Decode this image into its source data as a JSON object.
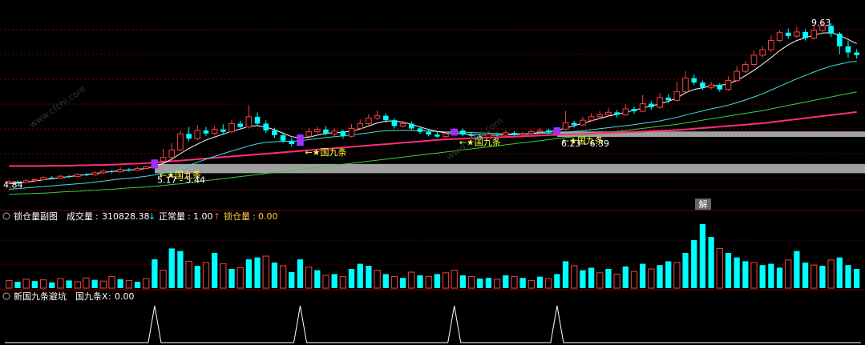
{
  "colors": {
    "background": "#000000",
    "up": "#FF4040",
    "down": "#00FFFF",
    "ma_white": "#FFFFFF",
    "ma_yellow": "#FFD040",
    "ma_magenta": "#FF2E7A",
    "ma_cyan": "#40E0E0",
    "ma_green": "#38D038",
    "signal_purple": "#9B30FF",
    "signal_text": "#FFFF40",
    "grid_red": "#7A0000",
    "band_gray": "#A0A0A0",
    "spike": "#FFFFFF"
  },
  "chart_data": [
    {
      "type": "candlestick",
      "title": "",
      "ylim": [
        4.5,
        10.0
      ],
      "annotations": {
        "high_label": "9.63",
        "low_label": "4.84",
        "band_lower_label": "5.17 - 5.44",
        "band_upper_label": "6.23 - 6.39",
        "signal_label": "←★国九条",
        "button_label": "解"
      },
      "signal_indices": [
        17,
        34,
        52,
        64
      ],
      "band_lower": [
        5.17,
        5.44
      ],
      "band_upper": [
        6.23,
        6.39
      ],
      "candles": [
        [
          4.88,
          4.92,
          4.97,
          4.84
        ],
        [
          4.92,
          4.9,
          4.96,
          4.86
        ],
        [
          4.9,
          4.95,
          4.99,
          4.87
        ],
        [
          4.95,
          4.98,
          5.02,
          4.92
        ],
        [
          4.98,
          5.04,
          5.08,
          4.95
        ],
        [
          5.04,
          5.03,
          5.09,
          4.99
        ],
        [
          5.03,
          5.08,
          5.12,
          5.0
        ],
        [
          5.08,
          5.07,
          5.12,
          5.03
        ],
        [
          5.07,
          5.13,
          5.17,
          5.05
        ],
        [
          5.13,
          5.12,
          5.17,
          5.08
        ],
        [
          5.12,
          5.18,
          5.23,
          5.1
        ],
        [
          5.18,
          5.23,
          5.28,
          5.15
        ],
        [
          5.23,
          5.21,
          5.27,
          5.17
        ],
        [
          5.21,
          5.28,
          5.34,
          5.19
        ],
        [
          5.28,
          5.26,
          5.32,
          5.22
        ],
        [
          5.26,
          5.31,
          5.36,
          5.24
        ],
        [
          5.31,
          5.36,
          5.4,
          5.28
        ],
        [
          5.36,
          5.52,
          5.58,
          5.33
        ],
        [
          5.52,
          5.63,
          5.88,
          5.48
        ],
        [
          5.63,
          5.85,
          6.05,
          5.6
        ],
        [
          5.85,
          6.32,
          6.42,
          5.82
        ],
        [
          6.32,
          6.18,
          6.52,
          6.1
        ],
        [
          6.18,
          6.42,
          6.58,
          6.14
        ],
        [
          6.42,
          6.33,
          6.52,
          6.25
        ],
        [
          6.33,
          6.45,
          6.55,
          6.28
        ],
        [
          6.45,
          6.38,
          6.6,
          6.3
        ],
        [
          6.38,
          6.62,
          6.72,
          6.34
        ],
        [
          6.62,
          6.52,
          6.7,
          6.45
        ],
        [
          6.52,
          6.82,
          7.15,
          6.48
        ],
        [
          6.82,
          6.62,
          6.95,
          6.55
        ],
        [
          6.62,
          6.42,
          6.72,
          6.35
        ],
        [
          6.42,
          6.28,
          6.5,
          6.2
        ],
        [
          6.28,
          6.12,
          6.36,
          6.05
        ],
        [
          6.12,
          6.02,
          6.2,
          5.95
        ],
        [
          6.02,
          6.25,
          6.32,
          5.98
        ],
        [
          6.25,
          6.38,
          6.48,
          6.2
        ],
        [
          6.38,
          6.45,
          6.52,
          6.32
        ],
        [
          6.45,
          6.32,
          6.55,
          6.28
        ],
        [
          6.32,
          6.4,
          6.48,
          6.25
        ],
        [
          6.4,
          6.25,
          6.45,
          6.18
        ],
        [
          6.25,
          6.48,
          6.6,
          6.22
        ],
        [
          6.48,
          6.62,
          6.75,
          6.45
        ],
        [
          6.62,
          6.78,
          6.9,
          6.58
        ],
        [
          6.78,
          6.85,
          7.0,
          6.72
        ],
        [
          6.85,
          6.72,
          6.92,
          6.65
        ],
        [
          6.72,
          6.55,
          6.78,
          6.48
        ],
        [
          6.55,
          6.62,
          6.7,
          6.5
        ],
        [
          6.62,
          6.48,
          6.68,
          6.42
        ],
        [
          6.48,
          6.38,
          6.55,
          6.32
        ],
        [
          6.38,
          6.3,
          6.45,
          6.25
        ],
        [
          6.3,
          6.24,
          6.38,
          6.2
        ],
        [
          6.24,
          6.32,
          6.4,
          6.2
        ],
        [
          6.32,
          6.42,
          6.5,
          6.28
        ],
        [
          6.42,
          6.3,
          6.48,
          6.25
        ],
        [
          6.3,
          6.26,
          6.35,
          6.22
        ],
        [
          6.26,
          6.22,
          6.32,
          6.18
        ],
        [
          6.22,
          6.3,
          6.38,
          6.2
        ],
        [
          6.3,
          6.28,
          6.35,
          6.24
        ],
        [
          6.28,
          6.35,
          6.42,
          6.25
        ],
        [
          6.35,
          6.3,
          6.4,
          6.26
        ],
        [
          6.3,
          6.33,
          6.38,
          6.27
        ],
        [
          6.33,
          6.38,
          6.45,
          6.3
        ],
        [
          6.38,
          6.42,
          6.5,
          6.35
        ],
        [
          6.42,
          6.36,
          6.48,
          6.32
        ],
        [
          6.36,
          6.46,
          6.52,
          6.3
        ],
        [
          6.46,
          6.64,
          6.98,
          6.42
        ],
        [
          6.64,
          6.58,
          6.7,
          6.5
        ],
        [
          6.58,
          6.72,
          6.82,
          6.55
        ],
        [
          6.72,
          6.82,
          6.92,
          6.68
        ],
        [
          6.82,
          6.88,
          6.98,
          6.75
        ],
        [
          6.88,
          6.95,
          7.08,
          6.82
        ],
        [
          6.95,
          6.88,
          7.02,
          6.8
        ],
        [
          6.88,
          7.05,
          7.18,
          6.85
        ],
        [
          7.05,
          6.98,
          7.12,
          6.9
        ],
        [
          6.98,
          7.2,
          7.45,
          6.95
        ],
        [
          7.2,
          7.1,
          7.28,
          7.02
        ],
        [
          7.1,
          7.38,
          7.52,
          7.05
        ],
        [
          7.38,
          7.3,
          7.48,
          7.22
        ],
        [
          7.3,
          7.55,
          7.85,
          7.26
        ],
        [
          7.55,
          7.95,
          8.15,
          7.5
        ],
        [
          7.95,
          7.82,
          8.05,
          7.75
        ],
        [
          7.82,
          7.68,
          7.88,
          7.6
        ],
        [
          7.68,
          7.75,
          7.85,
          7.62
        ],
        [
          7.75,
          7.62,
          7.8,
          7.55
        ],
        [
          7.62,
          7.88,
          8.0,
          7.58
        ],
        [
          7.88,
          8.15,
          8.3,
          7.85
        ],
        [
          8.15,
          8.35,
          8.45,
          8.1
        ],
        [
          8.35,
          8.62,
          8.75,
          8.3
        ],
        [
          8.62,
          8.78,
          8.88,
          8.55
        ],
        [
          8.78,
          9.05,
          9.2,
          8.72
        ],
        [
          9.05,
          9.28,
          9.35,
          9.0
        ],
        [
          9.28,
          9.18,
          9.4,
          9.1
        ],
        [
          9.18,
          9.3,
          9.45,
          9.12
        ],
        [
          9.3,
          9.12,
          9.38,
          9.05
        ],
        [
          9.12,
          9.35,
          9.5,
          9.08
        ],
        [
          9.35,
          9.48,
          9.63,
          9.3
        ],
        [
          9.48,
          9.25,
          9.55,
          9.15
        ],
        [
          9.25,
          8.88,
          9.3,
          8.65
        ],
        [
          8.88,
          8.7,
          9.05,
          8.55
        ],
        [
          8.7,
          8.62,
          8.8,
          8.52
        ]
      ],
      "ma_white": [
        4.86,
        4.88,
        4.91,
        4.94,
        4.98,
        5.01,
        5.04,
        5.07,
        5.1,
        5.13,
        5.16,
        5.19,
        5.22,
        5.24,
        5.26,
        5.28,
        5.31,
        5.37,
        5.46,
        5.58,
        5.74,
        5.89,
        6.02,
        6.14,
        6.23,
        6.31,
        6.4,
        6.46,
        6.54,
        6.56,
        6.52,
        6.44,
        6.34,
        6.24,
        6.2,
        6.22,
        6.28,
        6.33,
        6.36,
        6.37,
        6.4,
        6.46,
        6.55,
        6.64,
        6.69,
        6.7,
        6.66,
        6.6,
        6.52,
        6.45,
        6.39,
        6.35,
        6.34,
        6.32,
        6.3,
        6.29,
        6.28,
        6.28,
        6.29,
        6.3,
        6.31,
        6.33,
        6.36,
        6.38,
        6.42,
        6.49,
        6.56,
        6.63,
        6.7,
        6.77,
        6.84,
        6.89,
        6.95,
        7.01,
        7.08,
        7.13,
        7.2,
        7.27,
        7.37,
        7.52,
        7.62,
        7.67,
        7.72,
        7.74,
        7.78,
        7.88,
        8.02,
        8.18,
        8.36,
        8.55,
        8.75,
        8.92,
        9.05,
        9.13,
        9.21,
        9.27,
        9.28,
        9.2,
        9.08,
        8.96
      ],
      "ma_cyan": [
        4.7,
        4.72,
        4.74,
        4.76,
        4.78,
        4.8,
        4.82,
        4.84,
        4.86,
        4.88,
        4.91,
        4.94,
        4.97,
        5.0,
        5.02,
        5.05,
        5.08,
        5.12,
        5.17,
        5.23,
        5.31,
        5.4,
        5.49,
        5.58,
        5.66,
        5.74,
        5.82,
        5.89,
        5.97,
        6.03,
        6.07,
        6.09,
        6.1,
        6.1,
        6.12,
        6.15,
        6.18,
        6.21,
        6.24,
        6.26,
        6.29,
        6.32,
        6.35,
        6.39,
        6.41,
        6.42,
        6.42,
        6.42,
        6.41,
        6.4,
        6.39,
        6.38,
        6.38,
        6.37,
        6.36,
        6.35,
        6.34,
        6.33,
        6.32,
        6.32,
        6.32,
        6.32,
        6.33,
        6.34,
        6.35,
        6.37,
        6.39,
        6.41,
        6.44,
        6.47,
        6.5,
        6.53,
        6.56,
        6.59,
        6.63,
        6.66,
        6.7,
        6.75,
        6.8,
        6.87,
        6.93,
        6.99,
        7.05,
        7.1,
        7.16,
        7.23,
        7.31,
        7.4,
        7.49,
        7.6,
        7.71,
        7.82,
        7.93,
        8.03,
        8.13,
        8.22,
        8.3,
        8.36,
        8.41,
        8.45
      ],
      "ma_magenta": [
        5.38,
        5.38,
        5.38,
        5.38,
        5.38,
        5.39,
        5.39,
        5.39,
        5.4,
        5.4,
        5.41,
        5.41,
        5.42,
        5.43,
        5.44,
        5.45,
        5.46,
        5.48,
        5.5,
        5.52,
        5.54,
        5.56,
        5.58,
        5.6,
        5.62,
        5.64,
        5.66,
        5.68,
        5.7,
        5.72,
        5.74,
        5.76,
        5.78,
        5.8,
        5.82,
        5.84,
        5.86,
        5.88,
        5.9,
        5.92,
        5.94,
        5.96,
        5.98,
        6.0,
        6.02,
        6.04,
        6.06,
        6.08,
        6.1,
        6.12,
        6.14,
        6.16,
        6.17,
        6.18,
        6.19,
        6.2,
        6.21,
        6.22,
        6.23,
        6.24,
        6.25,
        6.26,
        6.27,
        6.28,
        6.29,
        6.3,
        6.31,
        6.32,
        6.33,
        6.34,
        6.35,
        6.36,
        6.37,
        6.38,
        6.39,
        6.4,
        6.41,
        6.42,
        6.43,
        6.45,
        6.47,
        6.49,
        6.51,
        6.53,
        6.55,
        6.57,
        6.59,
        6.61,
        6.63,
        6.66,
        6.69,
        6.72,
        6.75,
        6.78,
        6.81,
        6.84,
        6.87,
        6.9,
        6.93,
        6.96
      ],
      "ma_green": [
        4.55,
        4.56,
        4.57,
        4.58,
        4.59,
        4.6,
        4.62,
        4.63,
        4.64,
        4.66,
        4.67,
        4.69,
        4.7,
        4.72,
        4.74,
        4.75,
        4.77,
        4.79,
        4.81,
        4.84,
        4.86,
        4.89,
        4.92,
        4.95,
        4.98,
        5.01,
        5.04,
        5.07,
        5.1,
        5.13,
        5.16,
        5.19,
        5.22,
        5.25,
        5.28,
        5.31,
        5.34,
        5.37,
        5.4,
        5.43,
        5.46,
        5.49,
        5.52,
        5.55,
        5.58,
        5.61,
        5.64,
        5.67,
        5.7,
        5.73,
        5.76,
        5.79,
        5.82,
        5.85,
        5.88,
        5.91,
        5.94,
        5.97,
        6.0,
        6.03,
        6.06,
        6.09,
        6.12,
        6.15,
        6.18,
        6.21,
        6.24,
        6.27,
        6.3,
        6.33,
        6.36,
        6.39,
        6.42,
        6.45,
        6.48,
        6.51,
        6.54,
        6.57,
        6.6,
        6.64,
        6.68,
        6.72,
        6.76,
        6.8,
        6.84,
        6.88,
        6.92,
        6.96,
        7.0,
        7.05,
        7.1,
        7.15,
        7.2,
        7.25,
        7.3,
        7.35,
        7.4,
        7.45,
        7.5,
        7.55
      ]
    },
    {
      "type": "bar",
      "title": "锁仓量副图",
      "legend": [
        {
          "name": "成交量",
          "value": "310828.38",
          "arrow": "↓"
        },
        {
          "name": "正常量",
          "value": "1.00",
          "arrow": "↑"
        },
        {
          "name": "锁仓量",
          "value": "0.00",
          "arrow": ""
        }
      ],
      "volume_max": 1,
      "volumes": [
        0.12,
        0.1,
        0.14,
        0.11,
        0.13,
        0.09,
        0.15,
        0.12,
        0.1,
        0.16,
        0.13,
        0.11,
        0.18,
        0.14,
        0.12,
        0.1,
        0.15,
        0.45,
        0.28,
        0.62,
        0.58,
        0.42,
        0.35,
        0.4,
        0.55,
        0.38,
        0.3,
        0.32,
        0.45,
        0.48,
        0.5,
        0.4,
        0.35,
        0.25,
        0.45,
        0.33,
        0.28,
        0.2,
        0.22,
        0.18,
        0.3,
        0.38,
        0.35,
        0.28,
        0.22,
        0.18,
        0.16,
        0.25,
        0.2,
        0.18,
        0.22,
        0.24,
        0.28,
        0.2,
        0.18,
        0.15,
        0.16,
        0.14,
        0.2,
        0.18,
        0.16,
        0.12,
        0.18,
        0.15,
        0.22,
        0.42,
        0.35,
        0.28,
        0.32,
        0.24,
        0.3,
        0.22,
        0.34,
        0.26,
        0.38,
        0.3,
        0.36,
        0.42,
        0.4,
        0.55,
        0.75,
        1.0,
        0.8,
        0.62,
        0.55,
        0.48,
        0.42,
        0.4,
        0.36,
        0.38,
        0.32,
        0.44,
        0.58,
        0.4,
        0.36,
        0.35,
        0.44,
        0.48,
        0.36,
        0.3
      ],
      "series_flags": [
        0,
        1,
        0,
        1,
        0,
        1,
        0,
        1,
        0,
        0,
        1,
        0,
        0,
        1,
        0,
        1,
        0,
        1,
        0,
        1,
        1,
        0,
        1,
        0,
        1,
        0,
        1,
        0,
        1,
        1,
        0,
        1,
        0,
        1,
        1,
        0,
        1,
        0,
        1,
        0,
        1,
        1,
        1,
        0,
        1,
        0,
        1,
        0,
        1,
        0,
        1,
        0,
        0,
        1,
        0,
        1,
        1,
        0,
        1,
        0,
        1,
        0,
        1,
        0,
        1,
        1,
        0,
        1,
        1,
        0,
        1,
        0,
        1,
        0,
        1,
        0,
        1,
        1,
        0,
        1,
        1,
        1,
        1,
        0,
        1,
        1,
        1,
        0,
        1,
        1,
        1,
        0,
        1,
        1,
        0,
        1,
        0,
        1,
        1,
        1
      ]
    },
    {
      "type": "line",
      "title": "新国九条避坑",
      "legend": [
        {
          "name": "国九条X",
          "value": "0.00"
        }
      ],
      "spike_indices": [
        17,
        34,
        52,
        64
      ]
    }
  ],
  "watermark": "www.cfchi.com"
}
